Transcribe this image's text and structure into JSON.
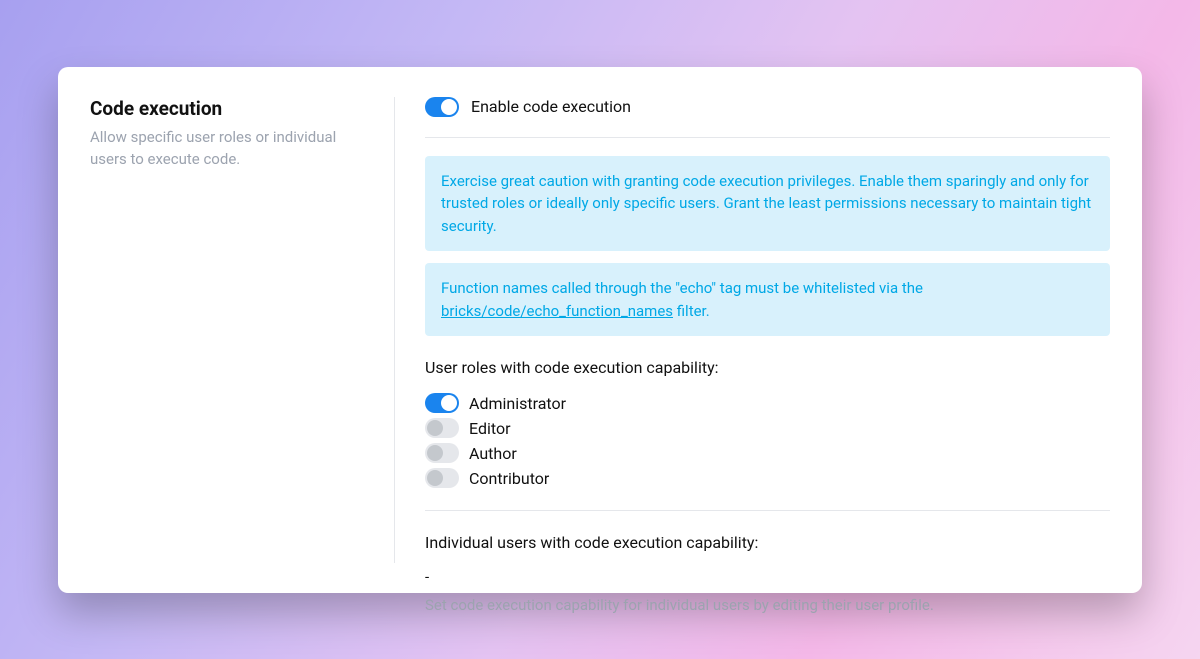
{
  "sidebar": {
    "title": "Code execution",
    "description": "Allow specific user roles or individual users to execute code."
  },
  "main": {
    "enable": {
      "label": "Enable code execution",
      "state": true
    },
    "notice_caution": "Exercise great caution with granting code execution privileges. Enable them sparingly and only for trusted roles or ideally only specific users. Grant the least permissions necessary to maintain tight security.",
    "notice_whitelist": {
      "prefix": "Function names called through the \"echo\" tag must be whitelisted via the ",
      "link_text": "bricks/code/echo_function_names",
      "suffix": " filter."
    },
    "roles_heading": "User roles with code execution capability:",
    "roles": [
      {
        "name": "Administrator",
        "enabled": true
      },
      {
        "name": "Editor",
        "enabled": false
      },
      {
        "name": "Author",
        "enabled": false
      },
      {
        "name": "Contributor",
        "enabled": false
      }
    ],
    "users_heading": "Individual users with code execution capability:",
    "users_placeholder": "-",
    "users_hint": "Set code execution capability for individual users by editing their user profile."
  }
}
